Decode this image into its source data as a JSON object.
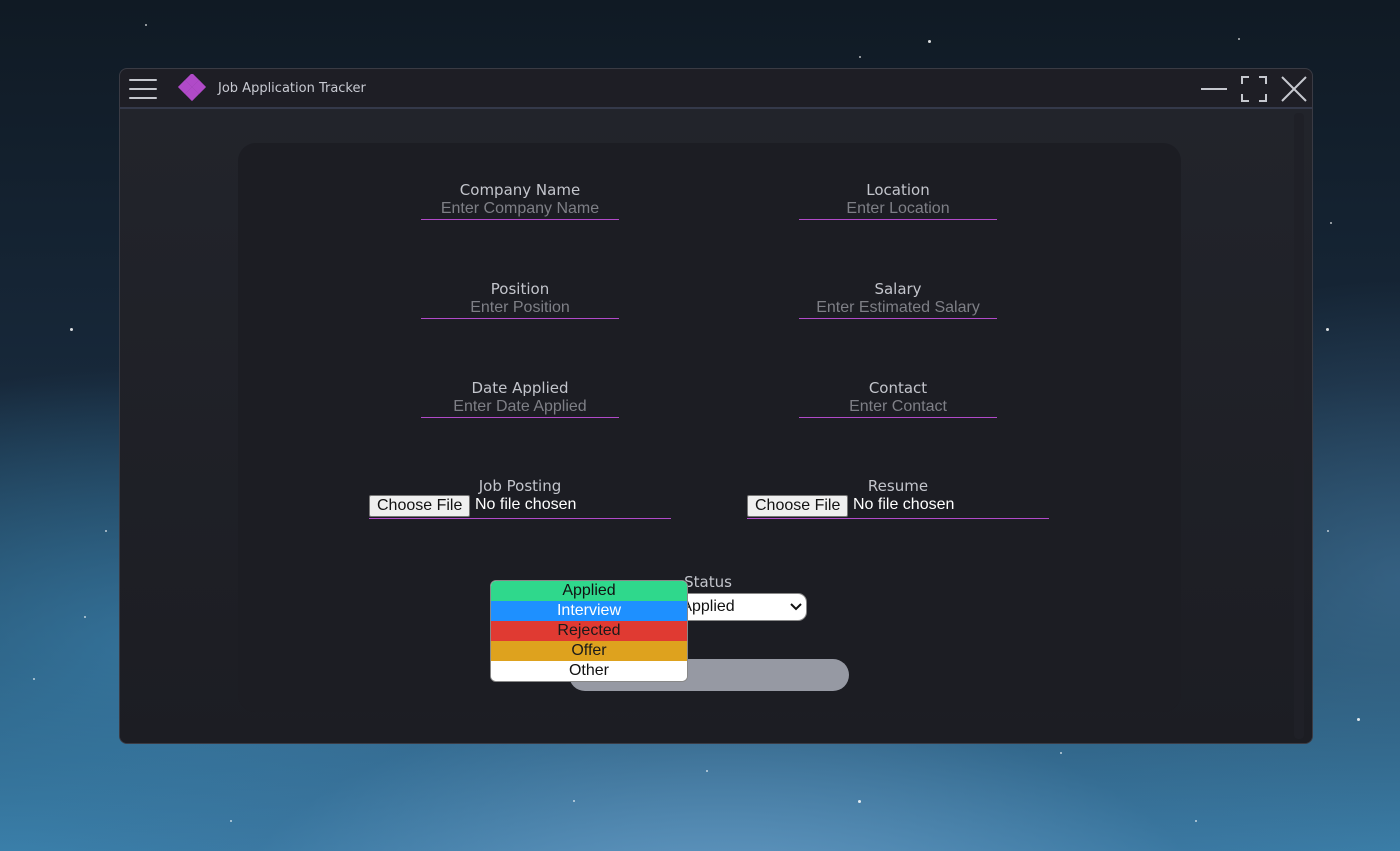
{
  "window": {
    "title": "Job Application Tracker",
    "accent": "#b04ac8"
  },
  "icons": {
    "menu": "hamburger-icon",
    "logo": "diamond-logo-icon",
    "minimize": "minimize-icon",
    "maximize": "maximize-icon",
    "close": "close-icon",
    "select_arrow": "chevron-down-icon"
  },
  "form": {
    "company_name": {
      "label": "Company Name",
      "placeholder": "Enter Company Name"
    },
    "location": {
      "label": "Location",
      "placeholder": "Enter Location"
    },
    "position": {
      "label": "Position",
      "placeholder": "Enter Position"
    },
    "salary": {
      "label": "Salary",
      "placeholder": "Enter Estimated Salary"
    },
    "date_applied": {
      "label": "Date Applied",
      "placeholder": "Enter Date Applied"
    },
    "contact": {
      "label": "Contact",
      "placeholder": "Enter Contact"
    },
    "job_posting": {
      "label": "Job Posting",
      "button": "Choose File",
      "file_text": "No file chosen"
    },
    "resume": {
      "label": "Resume",
      "button": "Choose File",
      "file_text": "No file chosen"
    },
    "status": {
      "label": "Status",
      "selected": "Applied",
      "options": [
        {
          "label": "Applied",
          "bg": "#2fd88c",
          "fg": "#111111"
        },
        {
          "label": "Interview",
          "bg": "#1e90ff",
          "fg": "#ffffff"
        },
        {
          "label": "Rejected",
          "bg": "#e03a32",
          "fg": "#1a1a1a"
        },
        {
          "label": "Offer",
          "bg": "#dea21e",
          "fg": "#1a1a1a"
        },
        {
          "label": "Other",
          "bg": "#ffffff",
          "fg": "#111111"
        }
      ]
    }
  }
}
